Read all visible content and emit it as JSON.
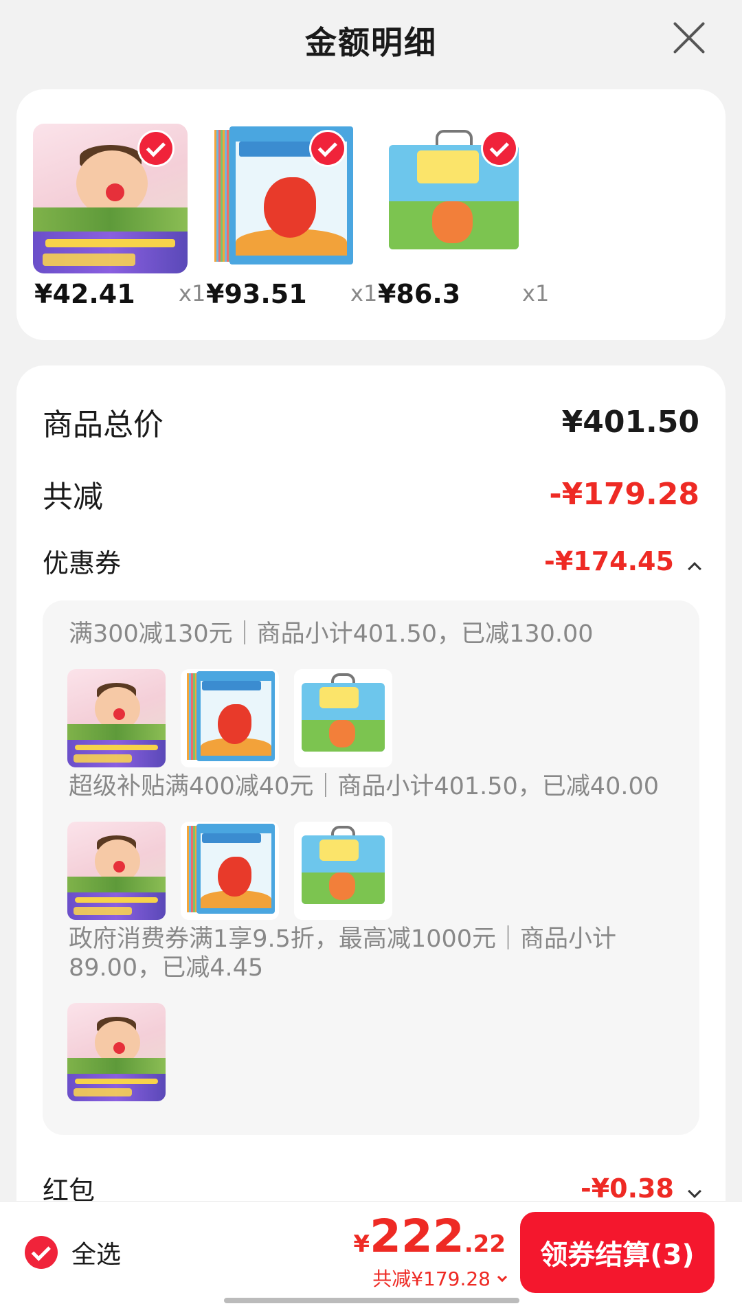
{
  "header": {
    "title": "金额明细"
  },
  "products": [
    {
      "price": "¥42.41",
      "qty": "x1"
    },
    {
      "price": "¥93.51",
      "qty": "x1"
    },
    {
      "price": "¥86.3",
      "qty": "x1"
    }
  ],
  "summary": {
    "total_label": "商品总价",
    "total_value": "¥401.50",
    "saved_label": "共减",
    "saved_value": "-¥179.28",
    "coupon_label": "优惠券",
    "coupon_value": "-¥174.45",
    "redpacket_label": "红包",
    "redpacket_value": "-¥0.38"
  },
  "coupons": [
    {
      "title": "满300减130元｜商品小计401.50，已减130.00"
    },
    {
      "title": "超级补贴满400减40元｜商品小计401.50，已减40.00"
    },
    {
      "title": "政府消费券满1享9.5折，最高减1000元｜商品小计89.00，已减4.45"
    }
  ],
  "bottom_bar": {
    "select_all": "全选",
    "total_currency": "¥",
    "total_int": "222",
    "total_dec": ".22",
    "total_saved": "共减¥179.28",
    "checkout_label": "领券结算(3)"
  },
  "colors": {
    "accent": "#ee2a24",
    "button": "#f4172d"
  }
}
